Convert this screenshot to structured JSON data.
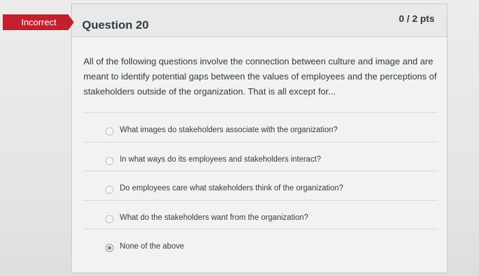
{
  "badge": {
    "label": "Incorrect"
  },
  "question": {
    "title": "Question 20",
    "points": "0 / 2 pts",
    "text": "All of the following questions involve the connection between culture and image and are meant to identify potential gaps between the values of employees and the perceptions of stakeholders outside of the organization.  That is all except for..."
  },
  "answers": [
    {
      "label": "What images do stakeholders associate with the organization?",
      "selected": false
    },
    {
      "label": "In what ways do its employees and stakeholders interact?",
      "selected": false
    },
    {
      "label": "Do employees care what stakeholders think of the organization?",
      "selected": false
    },
    {
      "label": "What do the stakeholders want from the organization?",
      "selected": false
    },
    {
      "label": "None of the above",
      "selected": true
    }
  ],
  "colors": {
    "badge": "#c3202d",
    "text": "#2d3b45"
  }
}
